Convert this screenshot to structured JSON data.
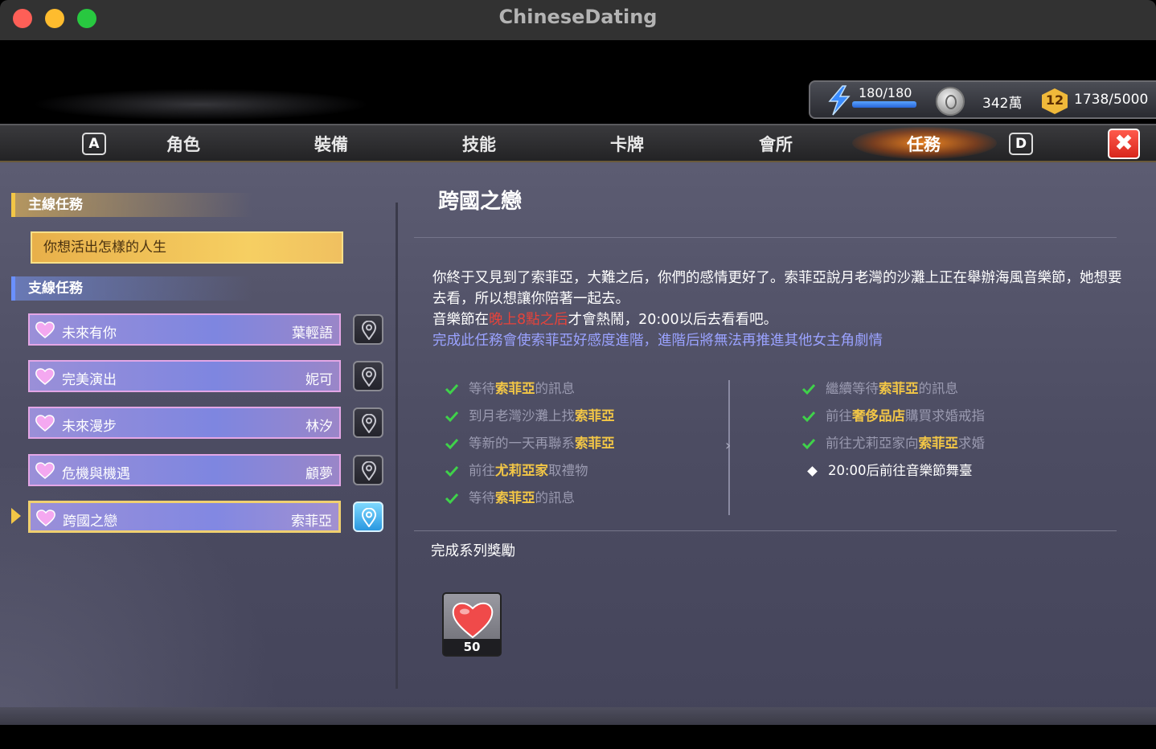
{
  "window": {
    "title": "ChineseDating"
  },
  "resources": {
    "energy": "180/180",
    "energy_fraction": 1.0,
    "coins": "342萬",
    "level": "12",
    "exp": "1738/5000"
  },
  "nav": {
    "key_left": "A",
    "key_right": "D",
    "tabs": [
      {
        "label": "角色"
      },
      {
        "label": "裝備"
      },
      {
        "label": "技能"
      },
      {
        "label": "卡牌"
      },
      {
        "label": "會所"
      },
      {
        "label": "任務"
      }
    ],
    "close_label": "✖"
  },
  "quests": {
    "main_header": "主線任務",
    "main_quest": "你想活出怎樣的人生",
    "side_header": "支線任務",
    "side": [
      {
        "name": "未來有你",
        "character": "葉輕語"
      },
      {
        "name": "完美演出",
        "character": "妮可"
      },
      {
        "name": "未來漫步",
        "character": "林汐"
      },
      {
        "name": "危機與機遇",
        "character": "顧夢"
      },
      {
        "name": "跨國之戀",
        "character": "索菲亞"
      }
    ]
  },
  "detail": {
    "title": "跨國之戀",
    "desc_line1": "你終于又見到了索菲亞，大難之后，你們的感情更好了。索菲亞說月老灣的沙灘上正在舉辦海風音樂節，她想要去看，所以想讓你陪著一起去。",
    "desc_line2_pre": "音樂節在",
    "desc_line2_red": "晚上8點之后",
    "desc_line2_post": "才會熱鬧，20:00以后去看看吧。",
    "desc_line3": "完成此任務會使索菲亞好感度進階，進階后將無法再推進其他女主角劇情",
    "objectives_left": [
      {
        "pre": "等待",
        "hl": "索菲亞",
        "post": "的訊息"
      },
      {
        "pre": "到月老灣沙灘上找",
        "hl": "索菲亞",
        "post": ""
      },
      {
        "pre": "等新的一天再聯系",
        "hl": "索菲亞",
        "post": ""
      },
      {
        "pre": "前往",
        "hl": "尤莉亞家",
        "post": "取禮物"
      },
      {
        "pre": "等待",
        "hl": "索菲亞",
        "post": "的訊息"
      }
    ],
    "objectives_right": [
      {
        "pre": "繼續等待",
        "hl": "索菲亞",
        "post": "的訊息"
      },
      {
        "pre": "前往",
        "hl": "奢侈品店",
        "post": "購買求婚戒指"
      },
      {
        "pre": "前往尤莉亞家向",
        "hl": "索菲亞",
        "post": "求婚"
      }
    ],
    "current_objective": "20:00后前往音樂節舞臺",
    "reward_title": "完成系列獎勵",
    "reward_count": "50"
  },
  "colors": {
    "accent_gold": "#f2c646",
    "warning_red": "#e8433a",
    "notice_blue": "#9aa2ff",
    "check_green": "#3fd24a"
  }
}
